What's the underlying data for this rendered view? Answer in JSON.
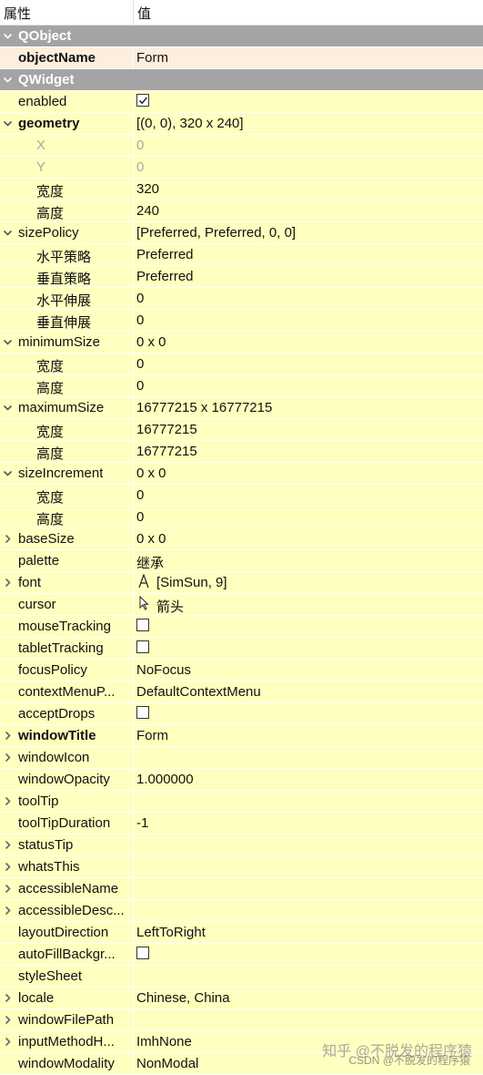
{
  "header": {
    "name_col": "属性",
    "value_col": "值"
  },
  "rows": [
    {
      "type": "cat",
      "name": "QObject",
      "expanded": true
    },
    {
      "name": "objectName",
      "value": "Form",
      "bold": true,
      "selected": true
    },
    {
      "type": "cat",
      "name": "QWidget",
      "expanded": true
    },
    {
      "name": "enabled",
      "check": true
    },
    {
      "name": "geometry",
      "value": "[(0, 0), 320 x 240]",
      "bold": true,
      "arrow": "down"
    },
    {
      "name": "X",
      "value": "0",
      "indent": 2,
      "disabled": true
    },
    {
      "name": "Y",
      "value": "0",
      "indent": 2,
      "disabled": true
    },
    {
      "name": "宽度",
      "value": "320",
      "indent": 2
    },
    {
      "name": "高度",
      "value": "240",
      "indent": 2
    },
    {
      "name": "sizePolicy",
      "value": "[Preferred, Preferred, 0, 0]",
      "arrow": "down"
    },
    {
      "name": "水平策略",
      "value": "Preferred",
      "indent": 2
    },
    {
      "name": "垂直策略",
      "value": "Preferred",
      "indent": 2
    },
    {
      "name": "水平伸展",
      "value": "0",
      "indent": 2
    },
    {
      "name": "垂直伸展",
      "value": "0",
      "indent": 2
    },
    {
      "name": "minimumSize",
      "value": "0 x 0",
      "arrow": "down"
    },
    {
      "name": "宽度",
      "value": "0",
      "indent": 2
    },
    {
      "name": "高度",
      "value": "0",
      "indent": 2
    },
    {
      "name": "maximumSize",
      "value": "16777215 x 16777215",
      "arrow": "down"
    },
    {
      "name": "宽度",
      "value": "16777215",
      "indent": 2
    },
    {
      "name": "高度",
      "value": "16777215",
      "indent": 2
    },
    {
      "name": "sizeIncrement",
      "value": "0 x 0",
      "arrow": "down"
    },
    {
      "name": "宽度",
      "value": "0",
      "indent": 2
    },
    {
      "name": "高度",
      "value": "0",
      "indent": 2
    },
    {
      "name": "baseSize",
      "value": "0 x 0",
      "arrow": "right"
    },
    {
      "name": "palette",
      "value": "继承"
    },
    {
      "name": "font",
      "value": "[SimSun, 9]",
      "arrow": "right",
      "icon": "font-icon"
    },
    {
      "name": "cursor",
      "value": "箭头",
      "icon": "cursor-arrow-icon"
    },
    {
      "name": "mouseTracking",
      "check": false
    },
    {
      "name": "tabletTracking",
      "check": false
    },
    {
      "name": "focusPolicy",
      "value": "NoFocus"
    },
    {
      "name": "contextMenuP...",
      "value": "DefaultContextMenu"
    },
    {
      "name": "acceptDrops",
      "check": false
    },
    {
      "name": "windowTitle",
      "value": "Form",
      "bold": true,
      "arrow": "right"
    },
    {
      "name": "windowIcon",
      "value": "",
      "arrow": "right"
    },
    {
      "name": "windowOpacity",
      "value": "1.000000"
    },
    {
      "name": "toolTip",
      "value": "",
      "arrow": "right"
    },
    {
      "name": "toolTipDuration",
      "value": "-1"
    },
    {
      "name": "statusTip",
      "value": "",
      "arrow": "right"
    },
    {
      "name": "whatsThis",
      "value": "",
      "arrow": "right"
    },
    {
      "name": "accessibleName",
      "value": "",
      "arrow": "right"
    },
    {
      "name": "accessibleDesc...",
      "value": "",
      "arrow": "right"
    },
    {
      "name": "layoutDirection",
      "value": "LeftToRight"
    },
    {
      "name": "autoFillBackgr...",
      "check": false
    },
    {
      "name": "styleSheet",
      "value": ""
    },
    {
      "name": "locale",
      "value": "Chinese, China",
      "arrow": "right"
    },
    {
      "name": "windowFilePath",
      "value": "",
      "arrow": "right"
    },
    {
      "name": "inputMethodH...",
      "value": "ImhNone",
      "arrow": "right"
    },
    {
      "name": "windowModality",
      "value": "NonModal"
    }
  ],
  "watermark": {
    "zhihu": "知乎 @不脱发的程序猿",
    "csdn": "CSDN @不脱发的程序猿"
  },
  "colors": {
    "category_bg": "#a4a4a4",
    "property_bg": "#ffffbf",
    "selected_bg": "#fdeedd"
  }
}
